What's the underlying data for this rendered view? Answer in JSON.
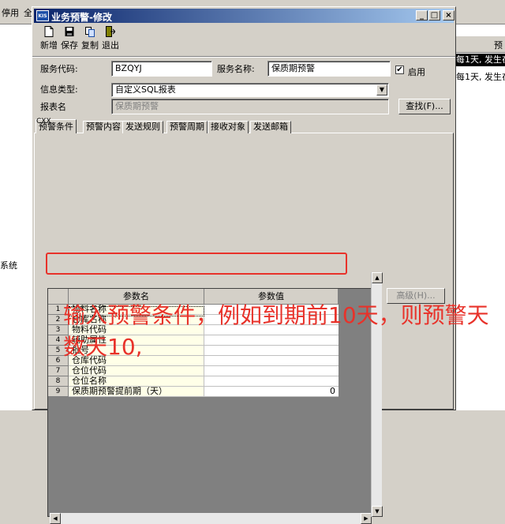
{
  "background": {
    "menu_items": [
      "停用",
      "全"
    ],
    "right_panel_header": "预",
    "right_rows": [
      "每1天, 发生在",
      "每1天, 发生在"
    ],
    "left_text": "系统"
  },
  "dialog": {
    "icon_text": "KIS",
    "title": "业务预警-修改",
    "window_buttons": {
      "minimize": "_",
      "maximize": "□",
      "close": "×"
    },
    "toolbar": [
      {
        "label": "新增",
        "icon": "new-doc-icon"
      },
      {
        "label": "保存",
        "icon": "save-disk-icon"
      },
      {
        "label": "复制",
        "icon": "copy-icon"
      },
      {
        "label": "退出",
        "icon": "exit-door-icon"
      }
    ],
    "form": {
      "code_label": "服务代码:",
      "code_value": "BZQYJ",
      "name_label": "服务名称:",
      "name_value": "保质期预警",
      "enable_label": "启用",
      "enable_checked": "✔",
      "infotype_label": "信息类型:",
      "infotype_value": "自定义SQL报表",
      "report_label": "报表名",
      "report_value": "保质期预警",
      "find_button": "查找(F)..."
    },
    "tabs": [
      "预警条件",
      "预警内容",
      "发送规则",
      "预警周期",
      "接收对象",
      "发送邮箱"
    ],
    "tab_overlay_text": "CXX",
    "grid": {
      "columns": [
        "参数名",
        "参数值"
      ],
      "rows": [
        {
          "n": "1",
          "name": "物料名称",
          "value": ""
        },
        {
          "n": "2",
          "name": "仓库名称",
          "value": ""
        },
        {
          "n": "3",
          "name": "物料代码",
          "value": ""
        },
        {
          "n": "4",
          "name": "辅助属性",
          "value": ""
        },
        {
          "n": "5",
          "name": "批号",
          "value": ""
        },
        {
          "n": "6",
          "name": "仓库代码",
          "value": ""
        },
        {
          "n": "7",
          "name": "仓位代码",
          "value": ""
        },
        {
          "n": "8",
          "name": "仓位名称",
          "value": ""
        },
        {
          "n": "9",
          "name": "保质期预警提前期（天）",
          "value": "0"
        }
      ]
    },
    "advanced_button": "高级(H)...",
    "annotation": "输入预警条件，例如到期前10天，则预警天数天10,"
  },
  "colors": {
    "highlight": "#e8322a",
    "title_start": "#0a246a",
    "title_end": "#a6caf0"
  }
}
